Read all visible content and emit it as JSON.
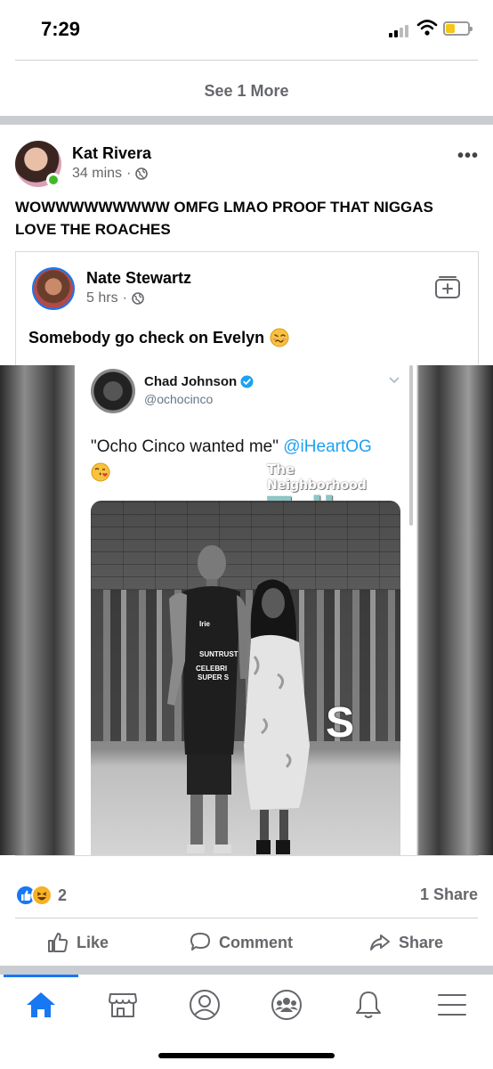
{
  "status_bar": {
    "time": "7:29"
  },
  "previous_post": {
    "see_more_label": "See 1 More"
  },
  "post": {
    "author": "Kat Rivera",
    "time": "34 mins",
    "separator": "·",
    "text": "WOWWWWWWWWW OMFG LMAO PROOF THAT NIGGAS LOVE THE ROACHES",
    "online": true
  },
  "shared_post": {
    "author": "Nate Stewartz",
    "time": "5 hrs",
    "separator": "·",
    "text": "Somebody go check on Evelyn",
    "emoji_icon": "woozy-face-icon",
    "image": {
      "tweet": {
        "name": "Chad Johnson",
        "handle": "@ochocinco",
        "text": "\"Ocho Cinco wanted me\" ",
        "mention": "@iHeartOG",
        "emoji_icon": "face-blowing-kiss-icon",
        "watermark_lines": [
          "The",
          "Neighborhood",
          "Talk"
        ],
        "jersey_lines": [
          "Irie",
          "SUNTRUST",
          "CELEBRI",
          "SUPER S"
        ],
        "court_letter": "S"
      }
    }
  },
  "engagement": {
    "reaction_icons": [
      "like-icon",
      "haha-icon"
    ],
    "reaction_count": "2",
    "share_count": "1 Share"
  },
  "actions": {
    "like_label": "Like",
    "comment_label": "Comment",
    "share_label": "Share"
  },
  "tabbar": {
    "active_tab": "home",
    "tabs": [
      "home-icon",
      "marketplace-icon",
      "profile-icon",
      "groups-icon",
      "notifications-icon",
      "menu-icon"
    ]
  },
  "colors": {
    "brand_blue": "#1877f2",
    "secondary_text": "#65676b",
    "online_green": "#42b72a",
    "twitter_blue": "#1da1f2"
  }
}
